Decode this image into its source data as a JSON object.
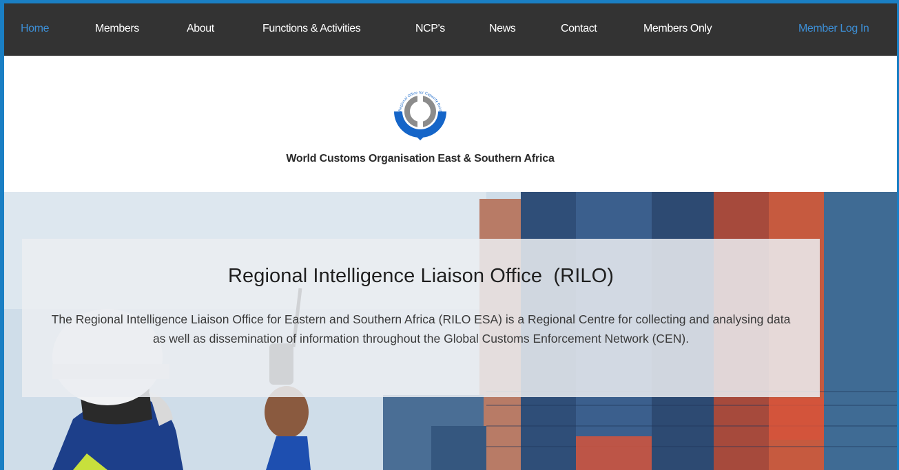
{
  "nav": {
    "items": [
      {
        "label": "Home",
        "active": true
      },
      {
        "label": "Members",
        "active": false
      },
      {
        "label": "About",
        "active": false
      },
      {
        "label": "Functions & Activities",
        "active": false
      },
      {
        "label": "NCP's",
        "active": false
      },
      {
        "label": "News",
        "active": false
      },
      {
        "label": "Contact",
        "active": false
      },
      {
        "label": "Members Only",
        "active": false
      }
    ],
    "login_label": "Member Log In"
  },
  "header": {
    "logo_ring_text": "Regional Office for Capacity Building",
    "org_name": "World Customs Organisation East & Southern Africa"
  },
  "hero": {
    "title": "Regional Intelligence Liaison Office  (RILO)",
    "description": "The Regional Intelligence Liaison Office for Eastern and Southern Africa (RILO ESA) is a Regional Centre for collecting and analysing data as well as dissemination of information throughout the Global Customs Enforcement Network (CEN)."
  },
  "colors": {
    "page_border": "#1a7fc4",
    "nav_background": "#333333",
    "nav_active": "#3d8fd6",
    "logo_blue": "#1565c8",
    "logo_grey": "#8c8c8c"
  }
}
